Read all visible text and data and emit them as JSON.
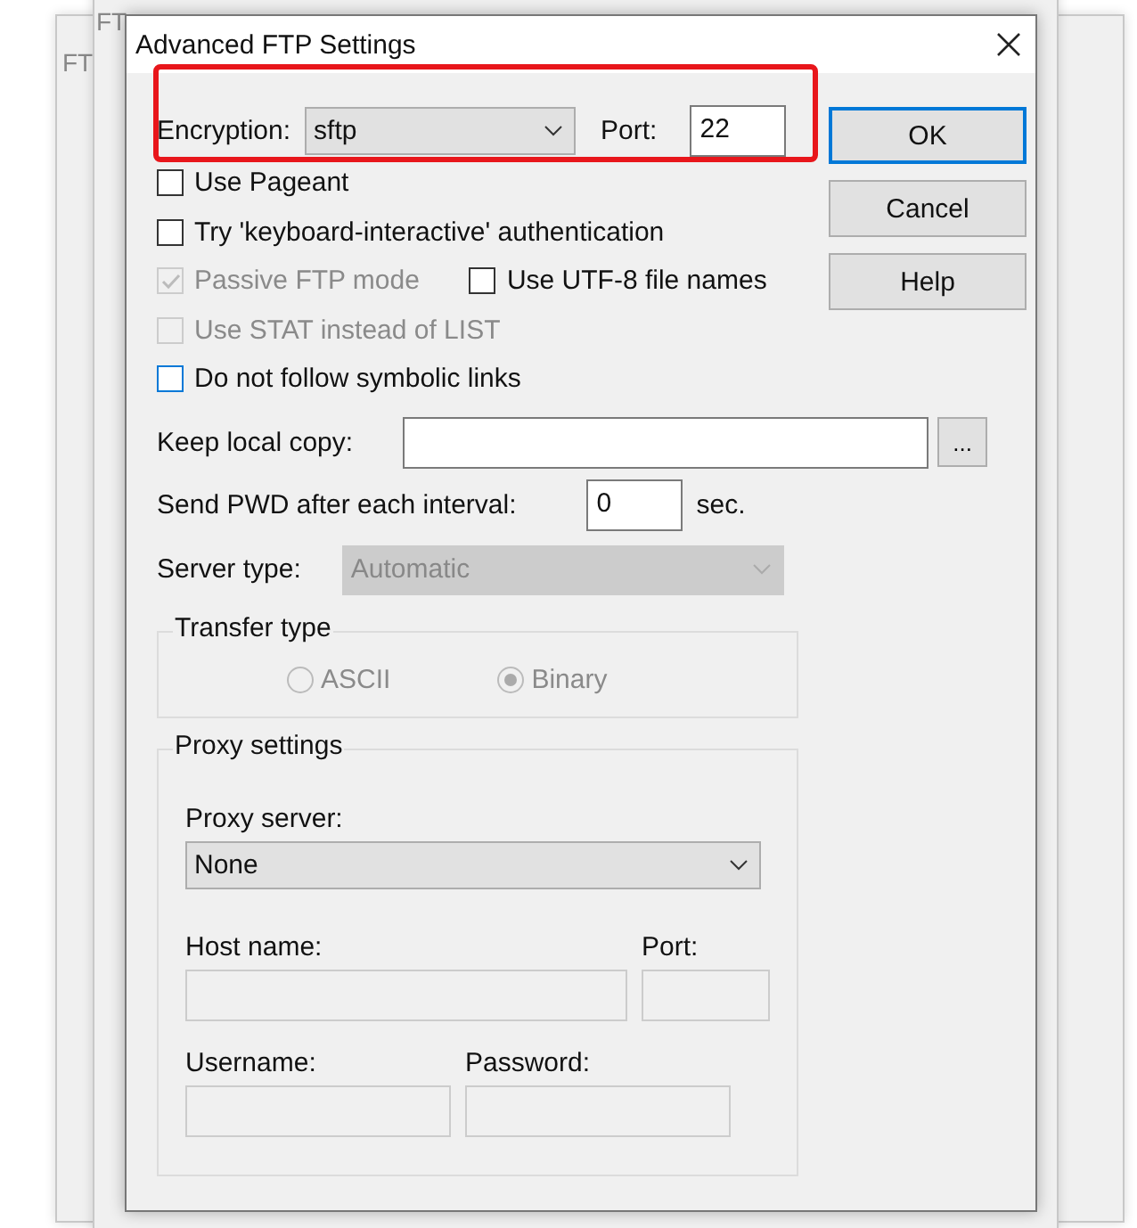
{
  "background_windows": [
    {
      "title": "FT"
    },
    {
      "title": "FT"
    }
  ],
  "dialog": {
    "title": "Advanced FTP Settings"
  },
  "encryption": {
    "label": "Encryption:",
    "value": "sftp"
  },
  "port": {
    "label": "Port:",
    "value": "22"
  },
  "checkbox_rows": [
    {
      "items": [
        {
          "label": "Use Pageant",
          "checked": false,
          "disabled": false,
          "focused": false
        }
      ]
    },
    {
      "items": [
        {
          "label": "Try 'keyboard-interactive' authentication",
          "checked": false,
          "disabled": false,
          "focused": false
        }
      ]
    },
    {
      "items": [
        {
          "label": "Passive FTP mode",
          "checked": true,
          "disabled": true,
          "focused": false
        },
        {
          "label": "Use UTF-8 file names",
          "checked": false,
          "disabled": false,
          "focused": false
        }
      ]
    },
    {
      "items": [
        {
          "label": "Use STAT instead of LIST",
          "checked": false,
          "disabled": true,
          "focused": false
        }
      ]
    },
    {
      "items": [
        {
          "label": "Do not follow symbolic links",
          "checked": false,
          "disabled": false,
          "focused": true
        }
      ]
    }
  ],
  "keep_local_copy": {
    "label": "Keep local copy:",
    "browse": "..."
  },
  "send_pwd": {
    "label": "Send PWD after each interval:",
    "value": "0",
    "unit": "sec."
  },
  "server_type": {
    "label": "Server type:",
    "value": "Automatic",
    "disabled": true
  },
  "transfer_type": {
    "title": "Transfer type",
    "disabled": true,
    "options": [
      {
        "label": "ASCII",
        "selected": false
      },
      {
        "label": "Binary",
        "selected": true
      }
    ]
  },
  "proxy": {
    "title": "Proxy settings",
    "server_label": "Proxy server:",
    "server_value": "None",
    "fields_disabled": true,
    "host": {
      "label": "Host name:"
    },
    "port": {
      "label": "Port:"
    },
    "username": {
      "label": "Username:"
    },
    "password": {
      "label": "Password:"
    }
  },
  "buttons": [
    {
      "label": "OK",
      "default": true
    },
    {
      "label": "Cancel",
      "default": false
    },
    {
      "label": "Help",
      "default": false
    }
  ],
  "highlight": {
    "shown": true
  }
}
